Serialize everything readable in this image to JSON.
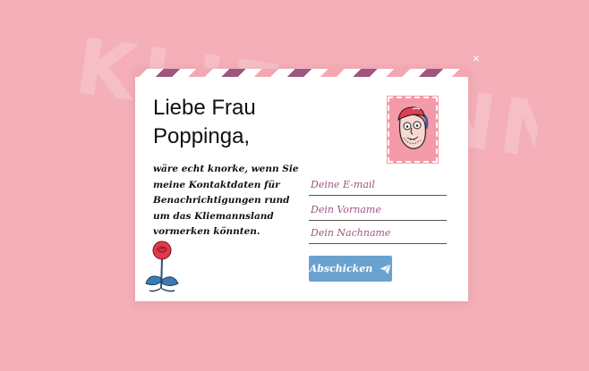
{
  "background_word": "KLIEMANNSLAND",
  "dialog": {
    "close_label": "×",
    "heading": "Liebe Frau Poppinga,",
    "intro": "wäre echt knorke, wenn Sie meine Kontaktdaten für Benachrichtigungen rund um das Kliemannsland vormerken könnten.",
    "email_placeholder": "Deine E-mail",
    "first_name_placeholder": "Dein Vorname",
    "last_name_placeholder": "Dein Nachname",
    "submit_label": "Abschicken",
    "icons": {
      "stamp": "portrait-stamp-icon",
      "rose": "rose-icon",
      "send": "paper-plane-icon"
    }
  },
  "colors": {
    "page_background": "#f4afb8",
    "accent_stripe": "#9c5680",
    "button": "#6aa2cf"
  }
}
